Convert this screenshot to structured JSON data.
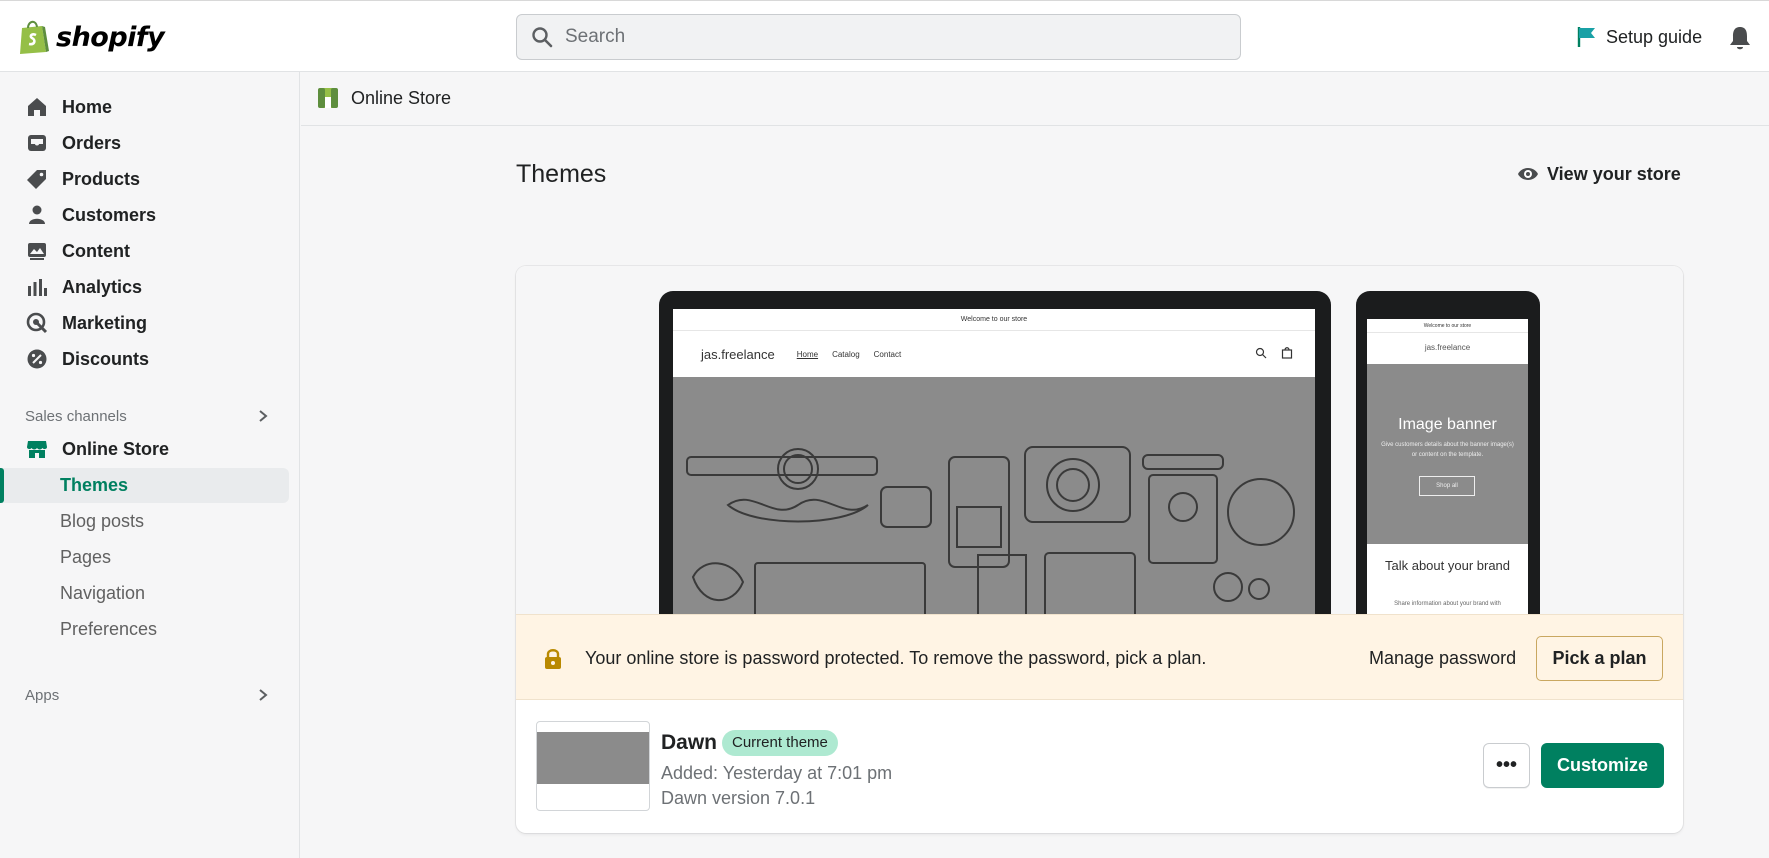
{
  "brand": {
    "name": "shopify",
    "accent": "#008060"
  },
  "search": {
    "placeholder": "Search"
  },
  "header": {
    "setup_guide": "Setup guide"
  },
  "sidebar": {
    "items": [
      {
        "label": "Home",
        "icon": "home-icon"
      },
      {
        "label": "Orders",
        "icon": "inbox-icon"
      },
      {
        "label": "Products",
        "icon": "tag-icon"
      },
      {
        "label": "Customers",
        "icon": "person-icon"
      },
      {
        "label": "Content",
        "icon": "image-icon"
      },
      {
        "label": "Analytics",
        "icon": "bar-chart-icon"
      },
      {
        "label": "Marketing",
        "icon": "target-icon"
      },
      {
        "label": "Discounts",
        "icon": "discount-icon"
      }
    ],
    "sales_channels_label": "Sales channels",
    "online_store": "Online Store",
    "sub_items": [
      "Themes",
      "Blog posts",
      "Pages",
      "Navigation",
      "Preferences"
    ],
    "apps_label": "Apps"
  },
  "breadcrumb": {
    "label": "Online Store"
  },
  "main": {
    "title": "Themes",
    "view_store": "View your store",
    "preview": {
      "announcement": "Welcome to our store",
      "store_name": "jas.freelance",
      "nav": [
        "Home",
        "Catalog",
        "Contact"
      ],
      "banner_title": "Image banner",
      "banner_text": "Give customers details about the banner image(s) or content on the template.",
      "banner_button": "Shop all",
      "talk_heading": "Talk about your brand",
      "share_text": "Share information about your brand with"
    },
    "password_banner": {
      "message": "Your online store is password protected. To remove the password, pick a plan.",
      "manage": "Manage password",
      "pick_plan": "Pick a plan"
    },
    "theme": {
      "name": "Dawn",
      "badge": "Current theme",
      "added": "Added: Yesterday at 7:01 pm",
      "version": "Dawn version 7.0.1",
      "more": "•••",
      "customize": "Customize"
    }
  }
}
